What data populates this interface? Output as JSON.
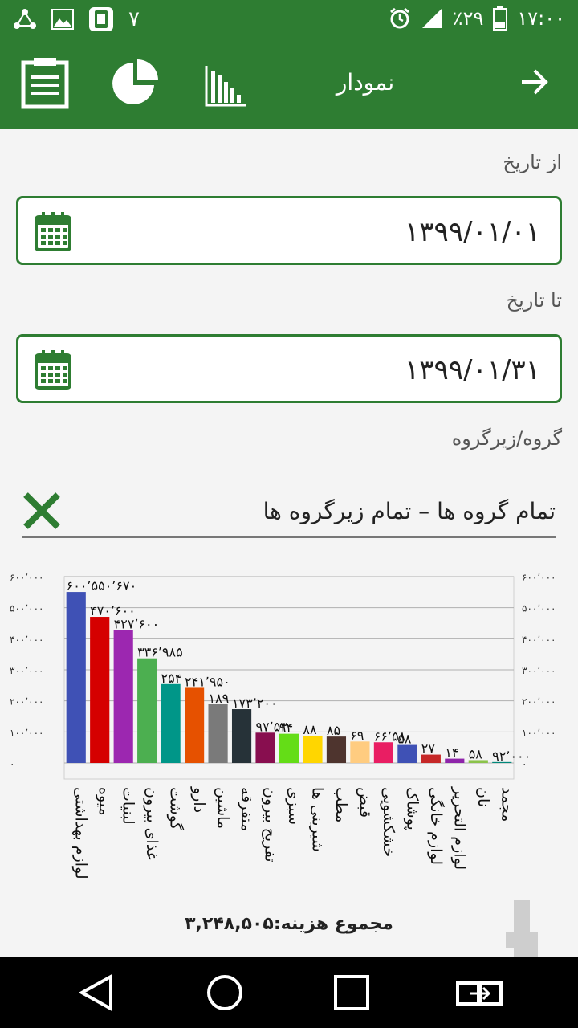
{
  "status_bar": {
    "notification_count": "۷",
    "battery": "٪۲۹",
    "time": "۱۷:۰۰",
    "icons": [
      "share-icon",
      "image-icon",
      "app-icon",
      "alarm-icon",
      "signal-icon",
      "battery-icon"
    ]
  },
  "app_bar": {
    "title": "نمودار",
    "icons": [
      "report-icon",
      "pie-chart-icon",
      "bar-chart-icon",
      "back-arrow-icon"
    ]
  },
  "form": {
    "from_label": "از تاریخ",
    "from_date": "۱۳۹۹/۰۱/۰۱",
    "to_label": "تا تاریخ",
    "to_date": "۱۳۹۹/۰۱/۳۱",
    "group_label": "گروه/زیرگروه",
    "filter_text": "تمام گروه ها – تمام زیرگروه ها"
  },
  "total_text": "مجموع هزینه:۳,۲۴۸,۵۰۵",
  "colors": {
    "accent": "#2e7d32"
  },
  "chart_data": {
    "type": "bar",
    "ylim": [
      0,
      600000
    ],
    "ytick_labels": [
      "۰",
      "۱۰۰٬۰۰۰",
      "۲۰۰٬۰۰۰",
      "۳۰۰٬۰۰۰",
      "۴۰۰٬۰۰۰",
      "۵۰۰٬۰۰۰",
      "۶۰۰٬۰۰۰"
    ],
    "grid": true,
    "categories": [
      "لوازم بهداشتی",
      "میوه",
      "لبنیات",
      "غذای بیرون",
      "گوشت",
      "دارو",
      "ماشین",
      "متفرقه",
      "تفریح بیرون",
      "سبزی",
      "شیرینی ها",
      "مطب",
      "قبض",
      "خشکشویی",
      "پوشاک",
      "لوازم خانگی",
      "لوازم التحریر",
      "نان",
      "مجمد"
    ],
    "values": [
      550670,
      470600,
      427600,
      336985,
      254000,
      241950,
      189000,
      173200,
      97530,
      94000,
      88000,
      85000,
      69000,
      66580,
      58000,
      27000,
      14000,
      9200,
      3000
    ],
    "value_labels": [
      "۶۰۰٬۵۵۰٬۶۷۰",
      "۴۷۰٬۶۰۰",
      "۴۲۷٬۶۰۰",
      "۳۳۶٬۹۸۵",
      "۲۵۴",
      "۲۴۱٬۹۵۰",
      "۱۸۹",
      "۱۷۳٬۲۰۰",
      "۹۷٬۵۳",
      "۹۴",
      "۸۸",
      "۸۵",
      "۶۹",
      "۶۶٬۵۸",
      "۵۸",
      "۲۷",
      "۱۴",
      "۵۸",
      "۹۲٬۰۰۰"
    ],
    "colors": [
      "#3f51b5",
      "#d50000",
      "#9c27b0",
      "#4caf50",
      "#009688",
      "#e65100",
      "#7a7a7a",
      "#263238",
      "#880e4f",
      "#64dd17",
      "#ffd600",
      "#4e342e",
      "#ffcc80",
      "#e91e63",
      "#3f51b5",
      "#c62828",
      "#8e24aa",
      "#8bc34a",
      "#00897b"
    ]
  }
}
